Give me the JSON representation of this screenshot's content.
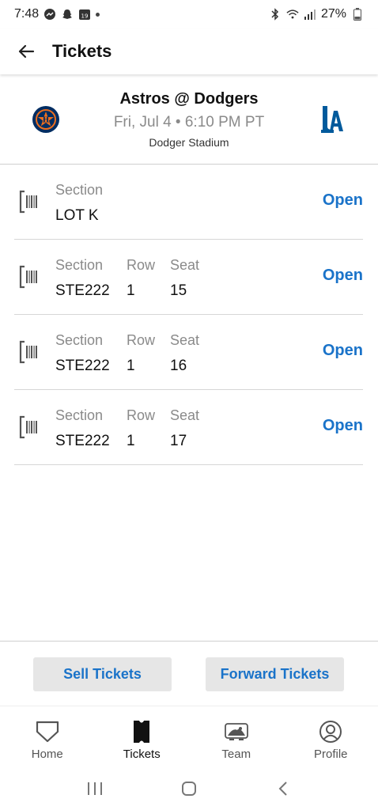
{
  "status_bar": {
    "time": "7:48",
    "battery": "27%",
    "notification_icons": [
      "messenger-icon",
      "snapchat-icon",
      "calendar-icon"
    ],
    "calendar_day": "19"
  },
  "header": {
    "title": "Tickets"
  },
  "game": {
    "matchup": "Astros @ Dodgers",
    "datetime": "Fri, Jul 4 • 6:10 PM PT",
    "venue": "Dodger Stadium",
    "away_logo": "astros-logo",
    "home_logo": "dodgers-logo"
  },
  "labels": {
    "section": "Section",
    "row": "Row",
    "seat": "Seat",
    "open": "Open"
  },
  "tickets": [
    {
      "section": "LOT K"
    },
    {
      "section": "STE222",
      "row": "1",
      "seat": "15"
    },
    {
      "section": "STE222",
      "row": "1",
      "seat": "16"
    },
    {
      "section": "STE222",
      "row": "1",
      "seat": "17"
    }
  ],
  "actions": {
    "sell": "Sell Tickets",
    "forward": "Forward Tickets"
  },
  "tabs": [
    {
      "label": "Home",
      "icon": "home-plate-icon"
    },
    {
      "label": "Tickets",
      "icon": "ticket-icon",
      "active": true
    },
    {
      "label": "Team",
      "icon": "team-icon"
    },
    {
      "label": "Profile",
      "icon": "profile-icon"
    }
  ],
  "colors": {
    "accent": "#1a73c9",
    "muted_text": "#8a8a8a",
    "button_bg": "#e6e6e6",
    "astros_navy": "#002d62",
    "astros_orange": "#eb6e1f",
    "dodgers_blue": "#005a9c"
  }
}
